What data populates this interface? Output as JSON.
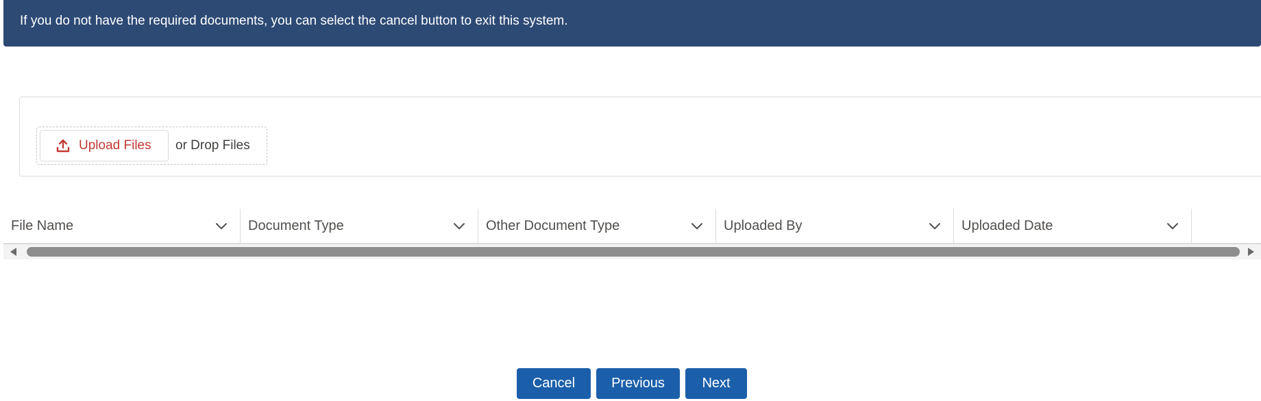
{
  "banner": {
    "message": "If you do not have the required documents, you can select the cancel button to exit this system."
  },
  "upload": {
    "button_label": "Upload Files",
    "drop_text": "or Drop Files",
    "icon": "upload-icon"
  },
  "table": {
    "columns": [
      {
        "label": "File Name"
      },
      {
        "label": "Document Type"
      },
      {
        "label": "Other Document Type"
      },
      {
        "label": "Uploaded By"
      },
      {
        "label": "Uploaded Date"
      }
    ],
    "rows": []
  },
  "footer": {
    "cancel_label": "Cancel",
    "previous_label": "Previous",
    "next_label": "Next"
  },
  "colors": {
    "banner_bg": "#2d4a75",
    "brand_button": "#1b5faa",
    "upload_accent": "#c23934"
  }
}
